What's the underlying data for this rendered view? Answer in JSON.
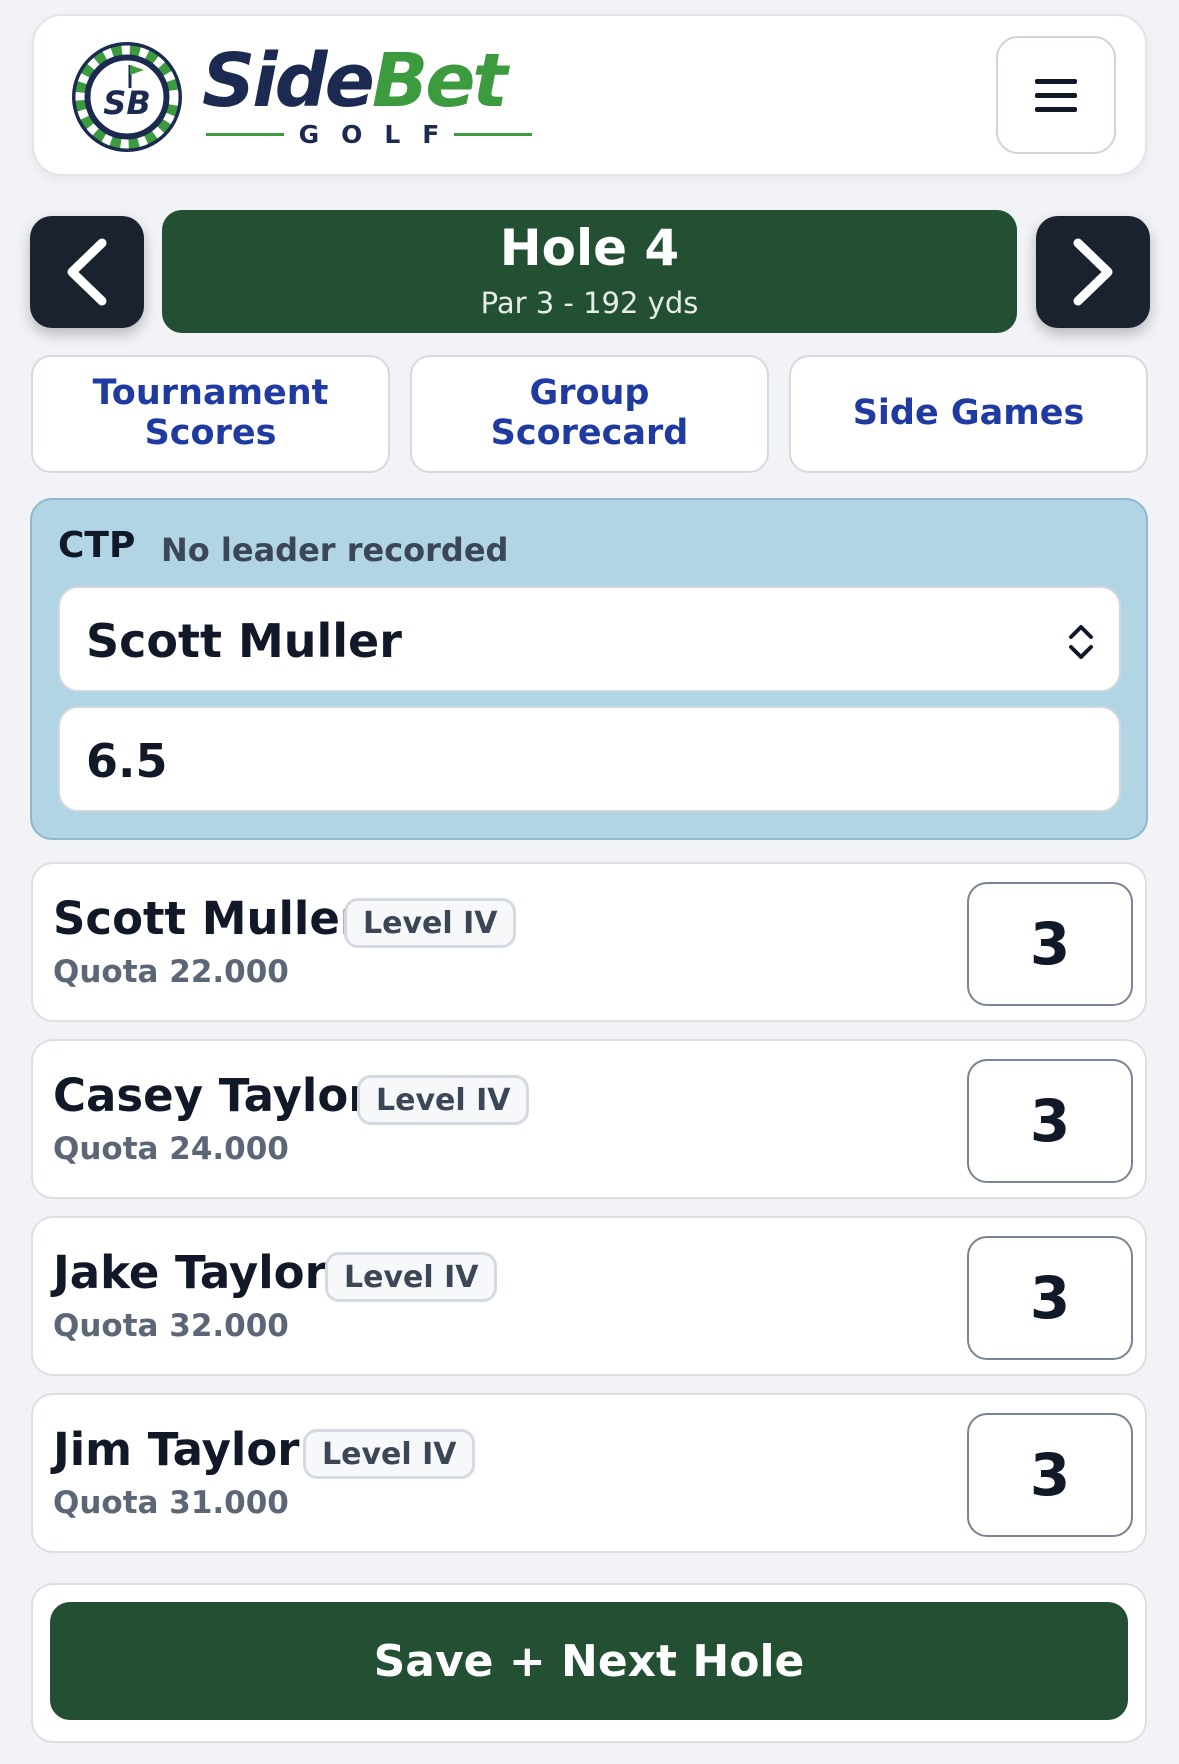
{
  "brand": {
    "badge_text": "SB",
    "name_part1": "Side",
    "name_part2": "Bet",
    "tagline": "GOLF",
    "colors": {
      "navy": "#1c2a52",
      "green": "#3d9b3f"
    }
  },
  "header": {
    "menu_icon": "hamburger-icon"
  },
  "hole": {
    "title": "Hole 4",
    "subtitle": "Par 3 - 192 yds",
    "prev_icon": "chevron-left-icon",
    "next_icon": "chevron-right-icon",
    "color": "#234f33"
  },
  "tabs": [
    {
      "label": "Tournament Scores"
    },
    {
      "label": "Group Scorecard"
    },
    {
      "label": "Side Games"
    }
  ],
  "ctp": {
    "label": "CTP",
    "status": "No leader recorded",
    "selected_player": "Scott Muller",
    "select_icon": "chevron-up-down-icon",
    "distance_value": "6.5",
    "panel_color": "#b2d5e5"
  },
  "players": [
    {
      "name": "Scott Muller",
      "level": "Level IV",
      "quota": "Quota 22.000",
      "score": "3"
    },
    {
      "name": "Casey Taylor",
      "level": "Level IV",
      "quota": "Quota 24.000",
      "score": "3"
    },
    {
      "name": "Jake Taylor",
      "level": "Level IV",
      "quota": "Quota 32.000",
      "score": "3"
    },
    {
      "name": "Jim Taylor",
      "level": "Level IV",
      "quota": "Quota 31.000",
      "score": "3"
    }
  ],
  "footer": {
    "save_label": "Save + Next Hole"
  }
}
